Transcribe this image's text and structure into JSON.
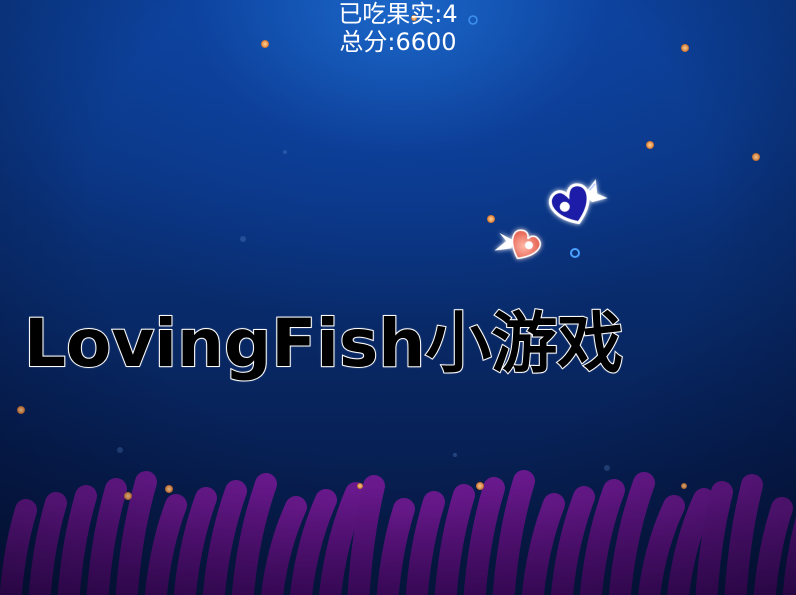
{
  "game": {
    "title": "LovingFish小游戏"
  },
  "hud": {
    "fruits_eaten_label": "已吃果实",
    "fruits_eaten_value": "4",
    "fruits_eaten_text": "已吃果实:4",
    "score_label": "总分",
    "score_value": "6600",
    "score_text": "总分:6600"
  },
  "colors": {
    "background_top": "#0b3f93",
    "background_bottom": "#061a44",
    "anemone": "#6a0f8a",
    "fruit_orange": "#f0a05a",
    "fruit_blue": "#4aa0ff",
    "mom_fish_body": "#1a1aa8",
    "baby_fish_body": "#f08070",
    "text": "#ffffff"
  }
}
